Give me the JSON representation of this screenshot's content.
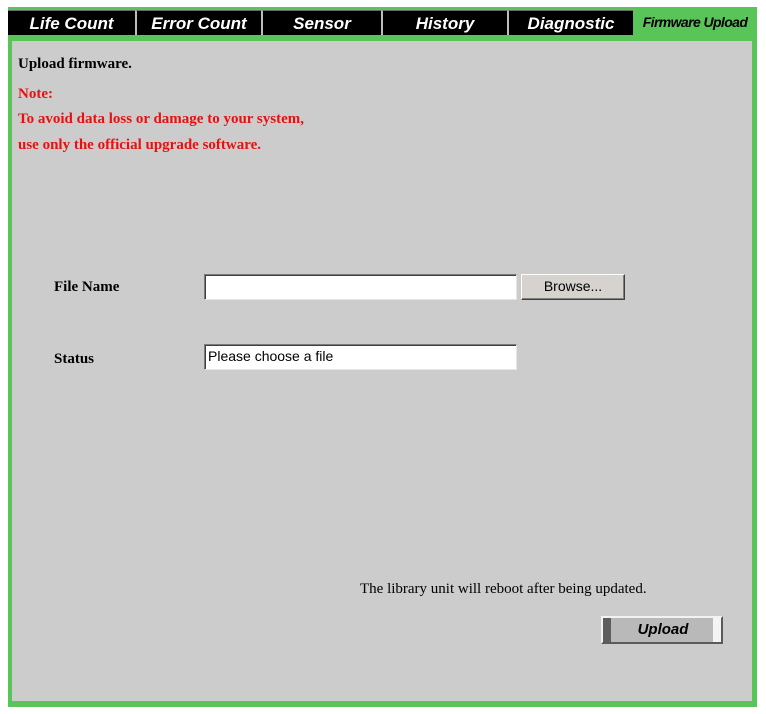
{
  "tabs": [
    {
      "label": "Life Count",
      "active": false
    },
    {
      "label": "Error Count",
      "active": false
    },
    {
      "label": "Sensor",
      "active": false
    },
    {
      "label": "History",
      "active": false
    },
    {
      "label": "Diagnostic",
      "active": false
    },
    {
      "label": "Firmware Upload",
      "active": true
    }
  ],
  "content": {
    "heading": "Upload firmware.",
    "note_label": "Note:",
    "note_line1": "To avoid data loss or damage to your system,",
    "note_line2": "use only the official upgrade software."
  },
  "form": {
    "file_name_label": "File Name",
    "file_name_value": "",
    "browse_label": "Browse...",
    "status_label": "Status",
    "status_value": "Please choose a file"
  },
  "footer": {
    "reboot_notice": "The library unit will reboot after being updated.",
    "upload_label": "Upload"
  },
  "colors": {
    "frame_green": "#59c559",
    "panel_gray": "#cccccc",
    "note_red": "#e81010",
    "tab_black": "#000000"
  }
}
